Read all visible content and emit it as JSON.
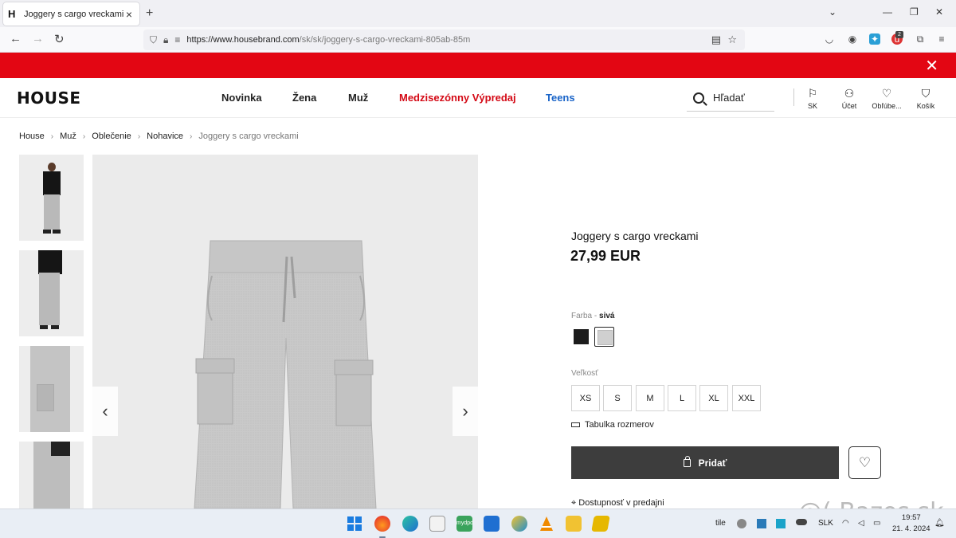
{
  "browser": {
    "tab_title": "Joggery s cargo vreckami Farba",
    "tab_favicon": "H",
    "url_domain": "https://www.housebrand.com",
    "url_path": "/sk/sk/joggery-s-cargo-vreckami-805ab-85m",
    "extension_badge": "2"
  },
  "header": {
    "logo": "HOUSE",
    "menu": [
      "Novinka",
      "Žena",
      "Muž",
      "Medzisezónny Výpredaj",
      "Teens"
    ],
    "search_placeholder": "Hľadať",
    "icons": [
      {
        "label": "SK",
        "icon": "flag-icon"
      },
      {
        "label": "Účet",
        "icon": "user-icon"
      },
      {
        "label": "Obľúbe...",
        "icon": "heart-icon"
      },
      {
        "label": "Košík",
        "icon": "bag-icon"
      }
    ]
  },
  "breadcrumb": [
    "House",
    "Muž",
    "Oblečenie",
    "Nohavice",
    "Joggery s cargo vreckami"
  ],
  "product": {
    "title": "Joggery s cargo vreckami",
    "price": "27,99 EUR",
    "color_label": "Farba - ",
    "color_value": "sivá",
    "swatches": [
      {
        "name": "black",
        "color": "#1c1c1c",
        "selected": false
      },
      {
        "name": "grey",
        "color": "#d0d0d0",
        "selected": true
      }
    ],
    "size_label": "Veľkosť",
    "sizes": [
      "XS",
      "S",
      "M",
      "L",
      "XL",
      "XXL"
    ],
    "size_chart": "Tabulka rozmerov",
    "add_button": "Pridať",
    "availability": "Dostupnosť v predajni"
  },
  "taskbar": {
    "tray_text": "SLK",
    "tray_extra": "tile",
    "time": "19:57",
    "date": "21. 4. 2024"
  },
  "watermark": "@( Bazos.sk",
  "colors": {
    "banner": "#e30613",
    "sale": "#d40915",
    "teens": "#1a64c8",
    "button": "#3d3d3d"
  }
}
